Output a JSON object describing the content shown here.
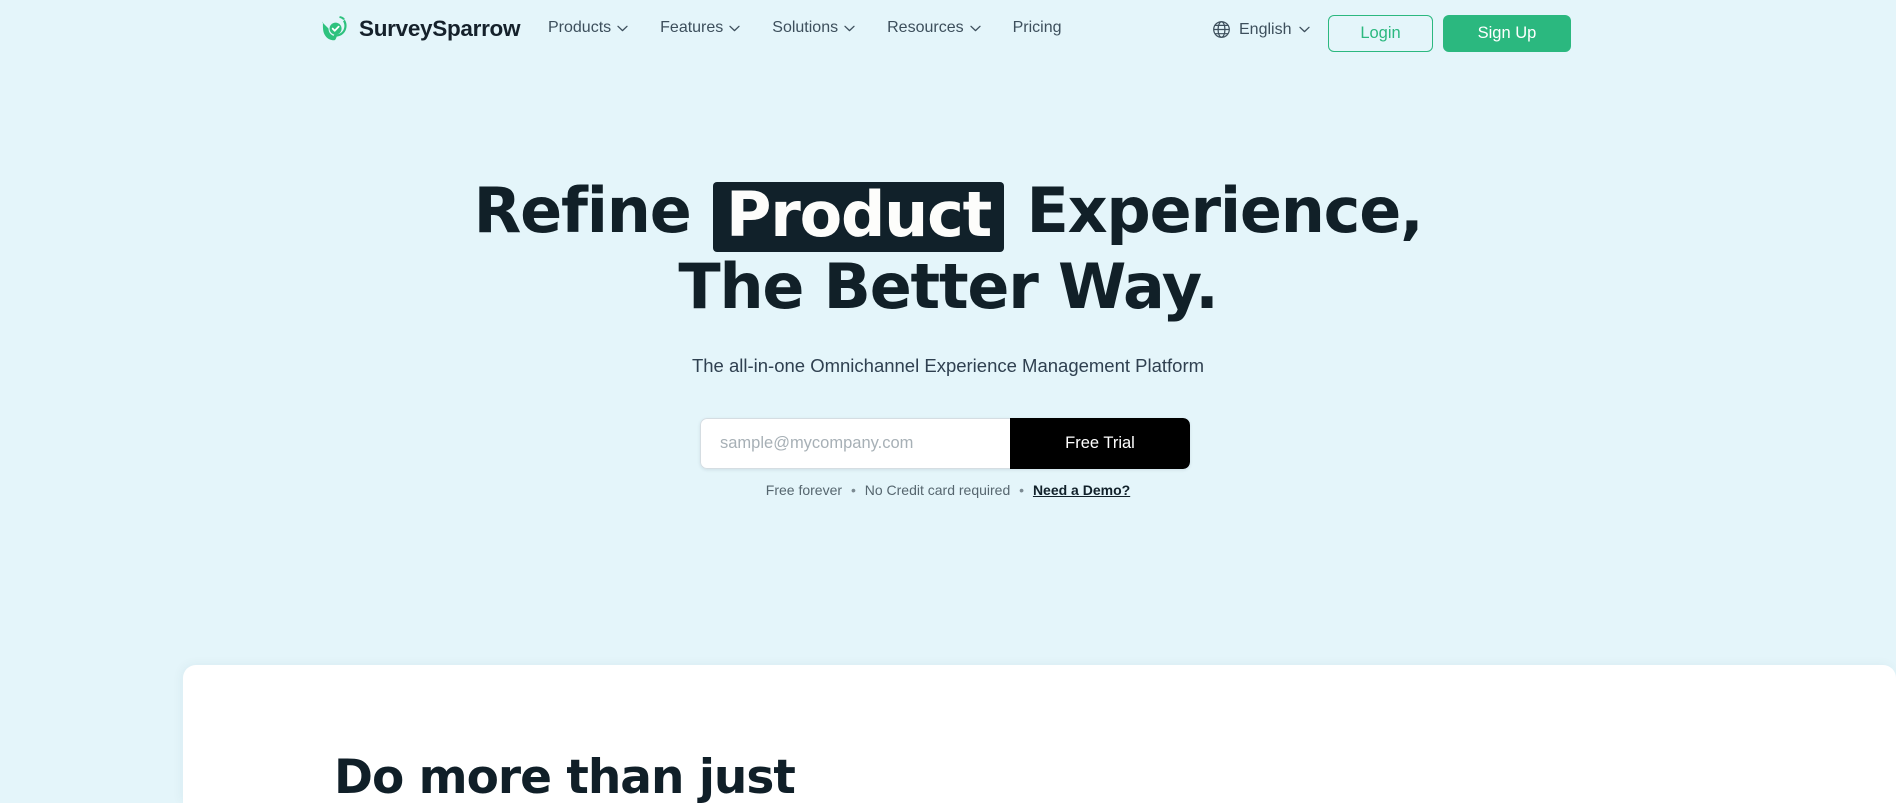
{
  "theme": {
    "page_bg": "#e4f5fa",
    "brand_green": "#2bb87f",
    "ink": "#112028",
    "muted": "#3d4f5c"
  },
  "navbar": {
    "brand": {
      "name": "SurveySparrow",
      "logo_icon": "sparrow-logo-icon"
    },
    "links": [
      {
        "label": "Products",
        "has_caret": true
      },
      {
        "label": "Features",
        "has_caret": true
      },
      {
        "label": "Solutions",
        "has_caret": true
      },
      {
        "label": "Resources",
        "has_caret": true
      },
      {
        "label": "Pricing",
        "has_caret": false
      }
    ],
    "language": {
      "label": "English",
      "icon": "globe-icon",
      "caret_icon": "chevron-down-icon"
    },
    "login_label": "Login",
    "signup_label": "Sign Up"
  },
  "hero": {
    "headline_part1": "Refine",
    "headline_highlight": "Product",
    "headline_part2": "Experience,",
    "headline_line2": "The Better Way.",
    "subtitle": "The all-in-one Omnichannel Experience Management Platform",
    "form": {
      "email_value": "",
      "email_placeholder": "sample@mycompany.com",
      "submit_label": "Free Trial"
    },
    "fineprint": {
      "item1": "Free forever",
      "sep1": "•",
      "item2": "No Credit card required",
      "sep2": "•",
      "demo_link": "Need a Demo?"
    }
  },
  "panel": {
    "heading": "Do more than just"
  }
}
